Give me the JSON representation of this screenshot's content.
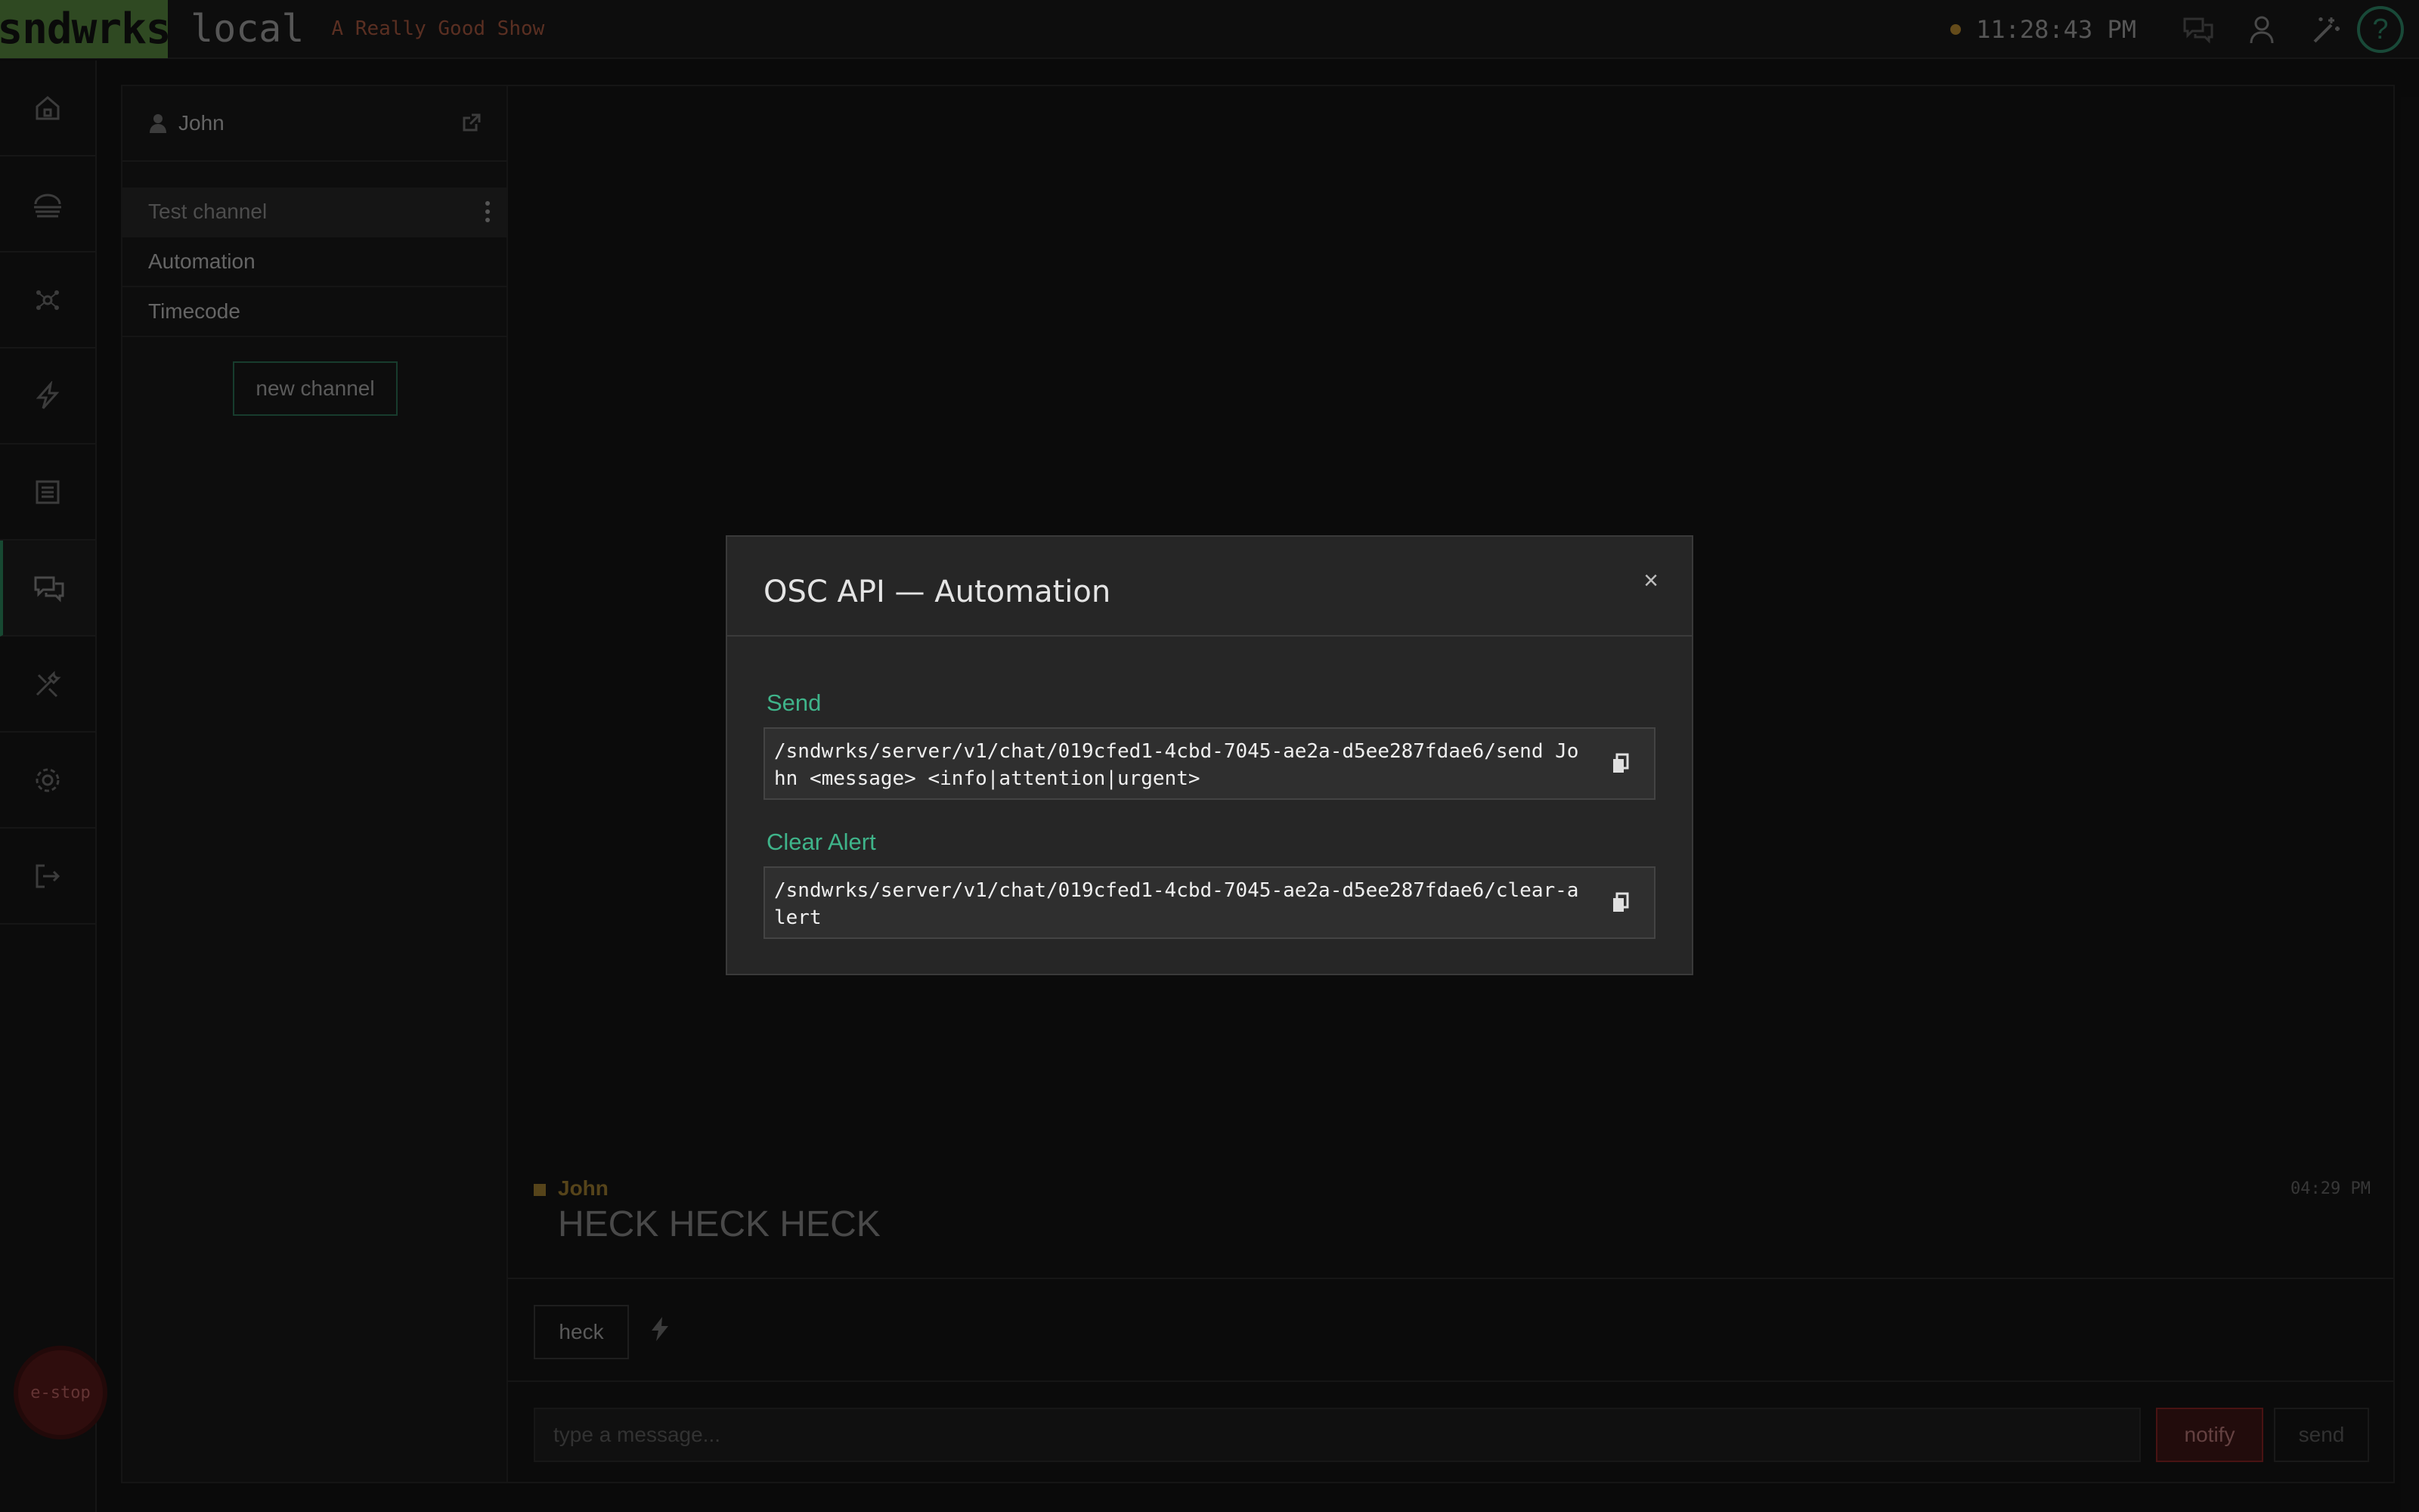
{
  "topbar": {
    "logo": "sndwrks",
    "environment": "local",
    "show_name": "A Really Good Show",
    "clock": "11:28:43 PM",
    "icons": [
      "chat-icon",
      "user-icon",
      "magic-wand-icon",
      "help-icon"
    ],
    "help_glyph": "?"
  },
  "leftnav": {
    "items": [
      {
        "icon": "home-icon"
      },
      {
        "icon": "stage-icon"
      },
      {
        "icon": "network-icon"
      },
      {
        "icon": "bolt-icon"
      },
      {
        "icon": "media-icon"
      },
      {
        "icon": "chat-icon",
        "active": true
      },
      {
        "icon": "tools-icon"
      },
      {
        "icon": "settings-icon"
      },
      {
        "icon": "logout-icon"
      }
    ],
    "estop_label": "e-stop"
  },
  "channels": {
    "user_name": "John",
    "items": [
      {
        "label": "Test channel",
        "selected": true
      },
      {
        "label": "Automation"
      },
      {
        "label": "Timecode"
      }
    ],
    "new_channel_label": "new channel"
  },
  "chat": {
    "messages": [
      {
        "author": "John",
        "time": "04:29 PM",
        "text": "HECK HECK HECK"
      }
    ],
    "quick_buttons": [
      "heck"
    ],
    "input_placeholder": "type a message...",
    "notify_label": "notify",
    "send_label": "send"
  },
  "modal": {
    "title": "OSC API — Automation",
    "close_glyph": "×",
    "endpoints": [
      {
        "label": "Send",
        "path": "/sndwrks/server/v1/chat/019cfed1-4cbd-7045-ae2a-d5ee287fdae6/send John <message> <info|attention|urgent>"
      },
      {
        "label": "Clear Alert",
        "path": "/sndwrks/server/v1/chat/019cfed1-4cbd-7045-ae2a-d5ee287fdae6/clear-alert"
      }
    ]
  },
  "colors": {
    "accent_green": "#3fb48a",
    "logo_bg": "#3a5a2a",
    "notify_red": "#5a1818"
  }
}
